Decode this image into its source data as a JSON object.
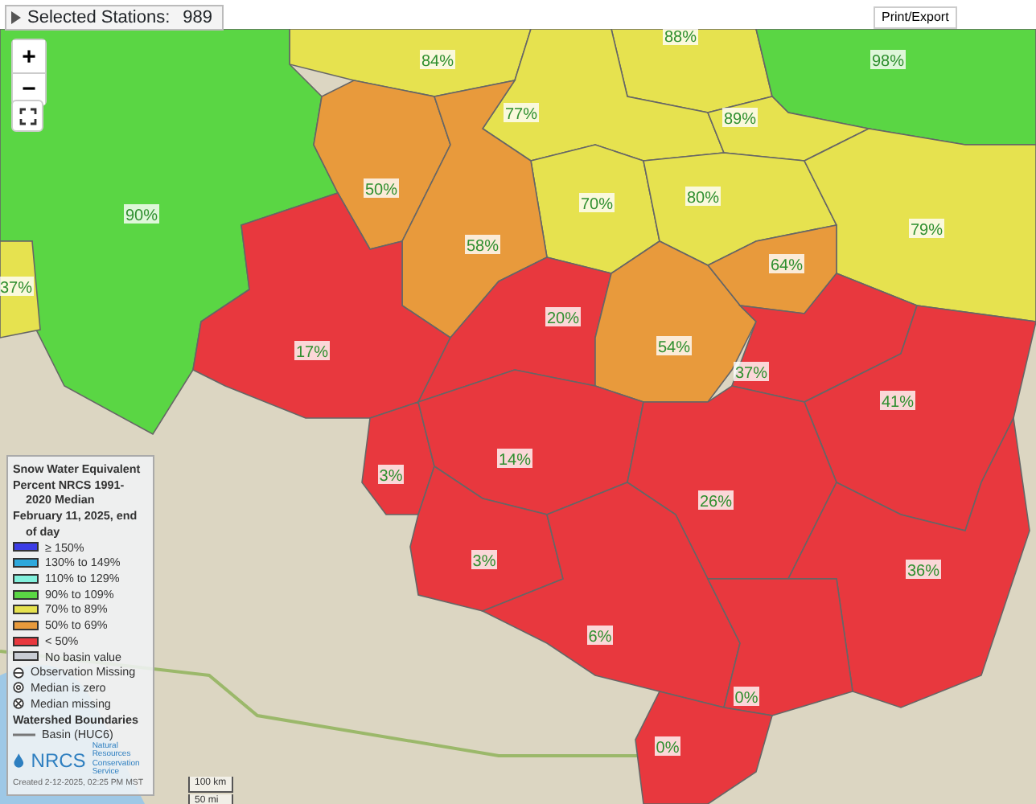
{
  "stations_panel": {
    "label": "Selected Stations:",
    "count": "989"
  },
  "map_controls": {
    "zoom_in": "+",
    "zoom_out": "−"
  },
  "print_button": "Print/Export",
  "basins": [
    {
      "label": "88%",
      "color": "#e6e24f"
    },
    {
      "label": "98%",
      "color": "#5ad644"
    },
    {
      "label": "84%",
      "color": "#e6e24f"
    },
    {
      "label": "77%",
      "color": "#e6e24f"
    },
    {
      "label": "89%",
      "color": "#e6e24f"
    },
    {
      "label": "90%",
      "color": "#5ad644"
    },
    {
      "label": "70%",
      "color": "#e6e24f"
    },
    {
      "label": "80%",
      "color": "#e6e24f"
    },
    {
      "label": "79%",
      "color": "#e6e24f"
    },
    {
      "label": "50%",
      "color": "#e89a3c"
    },
    {
      "label": "58%",
      "color": "#e89a3c"
    },
    {
      "label": "64%",
      "color": "#e89a3c"
    },
    {
      "label": "37%",
      "color": "#e6e24f"
    },
    {
      "label": "17%",
      "color": "#e8383e"
    },
    {
      "label": "20%",
      "color": "#e8383e"
    },
    {
      "label": "54%",
      "color": "#e89a3c"
    },
    {
      "label": "37%",
      "color": "#e8383e"
    },
    {
      "label": "41%",
      "color": "#e8383e"
    },
    {
      "label": "3%",
      "color": "#e8383e"
    },
    {
      "label": "14%",
      "color": "#e8383e"
    },
    {
      "label": "26%",
      "color": "#e8383e"
    },
    {
      "label": "3%",
      "color": "#e8383e"
    },
    {
      "label": "36%",
      "color": "#e8383e"
    },
    {
      "label": "6%",
      "color": "#e8383e"
    },
    {
      "label": "0%",
      "color": "#e8383e"
    },
    {
      "label": "0%",
      "color": "#e8383e"
    }
  ],
  "legend": {
    "title": "Snow Water Equivalent",
    "subtitle_1": "Percent NRCS 1991-",
    "subtitle_2": "2020 Median",
    "date_1": "February 11, 2025, end",
    "date_2": "of day",
    "items": [
      {
        "kind": "swatch",
        "label": "≥ 150%",
        "color": "#3c3ce6"
      },
      {
        "kind": "swatch",
        "label": "130% to 149%",
        "color": "#2ea8dc"
      },
      {
        "kind": "swatch",
        "label": "110% to 129%",
        "color": "#82f0dc"
      },
      {
        "kind": "swatch",
        "label": "90% to 109%",
        "color": "#5ad644"
      },
      {
        "kind": "swatch",
        "label": "70% to 89%",
        "color": "#e6e24f"
      },
      {
        "kind": "swatch",
        "label": "50% to 69%",
        "color": "#e89a3c"
      },
      {
        "kind": "swatch",
        "label": "< 50%",
        "color": "#e8383e"
      },
      {
        "kind": "swatch",
        "label": "No basin value",
        "color": "#c8ccd4"
      },
      {
        "kind": "obs-missing",
        "label": "Observation Missing"
      },
      {
        "kind": "median-zero",
        "label": "Median is zero"
      },
      {
        "kind": "median-missing",
        "label": "Median missing"
      }
    ],
    "boundaries_title": "Watershed Boundaries",
    "boundary_item": "Basin (HUC6)",
    "logo_text": "NRCS",
    "logo_subtext_1": "Natural Resources",
    "logo_subtext_2": "Conservation Service",
    "created": "Created 2-12-2025, 02:25 PM MST"
  },
  "scale_bar": {
    "metric": "100 km",
    "imperial": "50 mi"
  }
}
